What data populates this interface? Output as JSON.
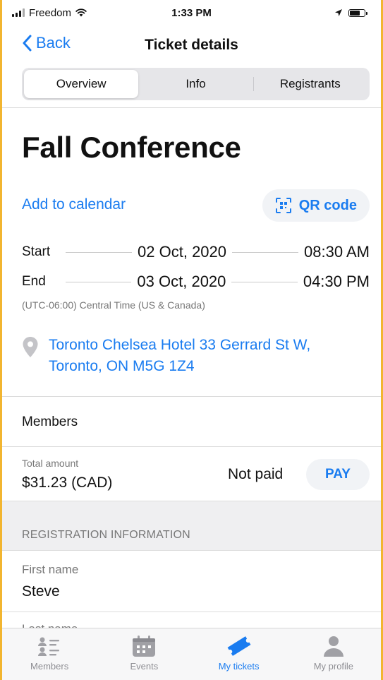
{
  "status_bar": {
    "carrier": "Freedom",
    "time": "1:33 PM"
  },
  "nav": {
    "back_label": "Back",
    "title": "Ticket details"
  },
  "segments": [
    {
      "label": "Overview",
      "active": true
    },
    {
      "label": "Info",
      "active": false
    },
    {
      "label": "Registrants",
      "active": false
    }
  ],
  "event": {
    "title": "Fall Conference",
    "add_to_calendar": "Add to calendar",
    "qr_code": "QR code",
    "start": {
      "label": "Start",
      "date": "02 Oct, 2020",
      "time": "08:30 AM"
    },
    "end": {
      "label": "End",
      "date": "03 Oct, 2020",
      "time": "04:30 PM"
    },
    "timezone": "(UTC-06:00) Central Time (US & Canada)",
    "location_line1": "Toronto Chelsea Hotel 33 Gerrard St W,",
    "location_line2": "Toronto, ON M5G 1Z4"
  },
  "members": {
    "label": "Members"
  },
  "payment": {
    "total_caption": "Total amount",
    "total_value": "$31.23 (CAD)",
    "status": "Not paid",
    "pay_label": "PAY"
  },
  "registration": {
    "section_title": "REGISTRATION INFORMATION",
    "fields": [
      {
        "label": "First name",
        "value": "Steve"
      },
      {
        "label": "Last name",
        "value": ""
      }
    ]
  },
  "tab_bar": {
    "items": [
      {
        "label": "Members",
        "icon": "members-list-icon",
        "active": false
      },
      {
        "label": "Events",
        "icon": "calendar-icon",
        "active": false
      },
      {
        "label": "My tickets",
        "icon": "ticket-icon",
        "active": true
      },
      {
        "label": "My profile",
        "icon": "person-icon",
        "active": false
      }
    ]
  },
  "colors": {
    "accent": "#1a7cf0",
    "inactive_tab": "#8e8e93",
    "frame": "#f2b530"
  }
}
